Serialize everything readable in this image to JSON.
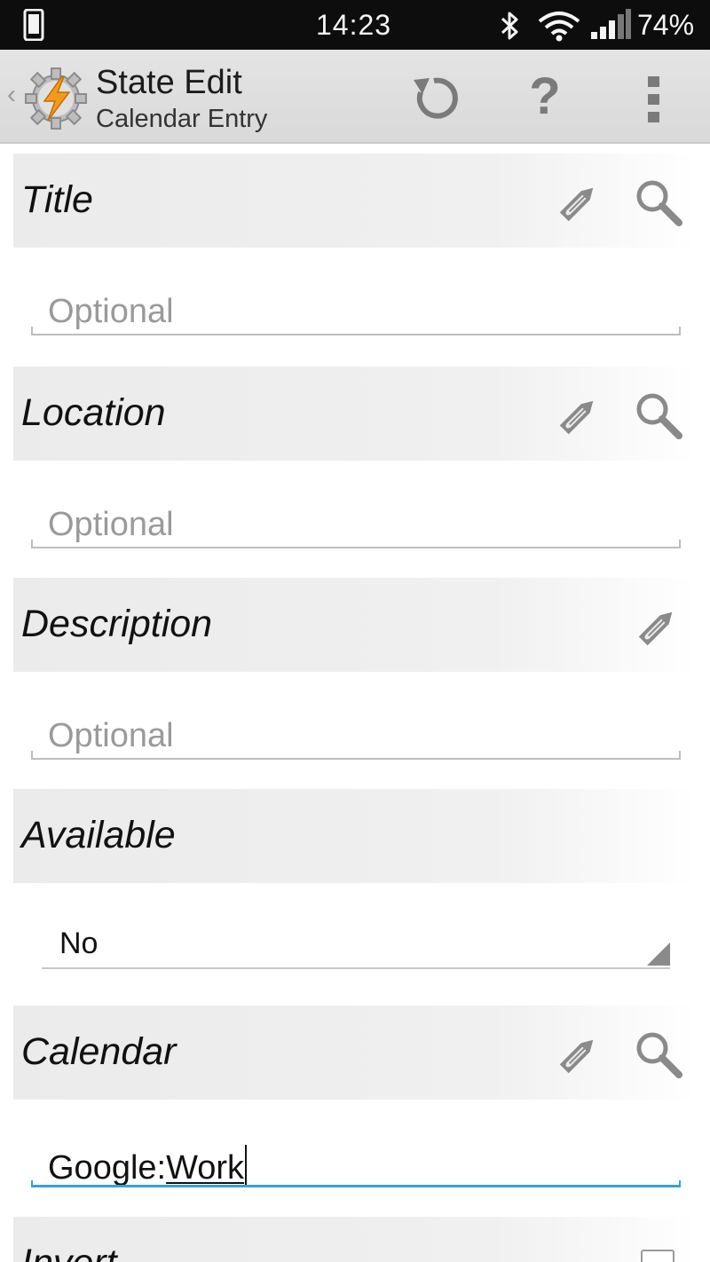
{
  "status_bar": {
    "time": "14:23",
    "battery": "74%",
    "icons": [
      "phone-icon",
      "bluetooth-icon",
      "wifi-icon",
      "signal-icon"
    ]
  },
  "action_bar": {
    "title": "State Edit",
    "subtitle": "Calendar Entry",
    "back_glyph": "‹",
    "help_glyph": "?",
    "icons": [
      "tasker-logo-icon",
      "undo-icon",
      "help-icon",
      "overflow-menu-icon"
    ]
  },
  "sections": {
    "title": {
      "label": "Title",
      "placeholder": "Optional",
      "icons": [
        "pencil-icon",
        "search-icon"
      ]
    },
    "location": {
      "label": "Location",
      "placeholder": "Optional",
      "icons": [
        "pencil-icon",
        "search-icon"
      ]
    },
    "description": {
      "label": "Description",
      "placeholder": "Optional",
      "icons": [
        "pencil-icon"
      ]
    },
    "available": {
      "label": "Available",
      "selected": "No"
    },
    "calendar": {
      "label": "Calendar",
      "value_prefix": "Google:",
      "value_composing": "Work",
      "icons": [
        "pencil-icon",
        "search-icon"
      ]
    },
    "invert": {
      "label": "Invert",
      "checked": false
    }
  },
  "colors": {
    "accent": "#33a3d6",
    "section_bg": "#ebebeb",
    "icon_gray": "#8a8a8a"
  }
}
